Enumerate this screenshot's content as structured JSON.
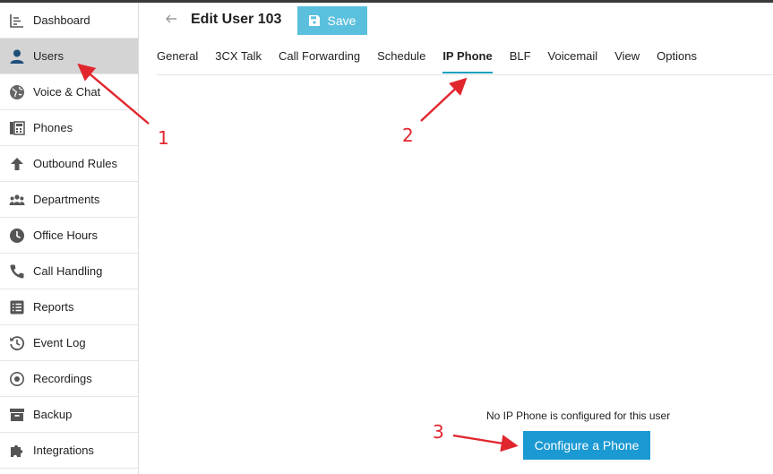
{
  "sidebar": {
    "items": [
      {
        "label": "Dashboard",
        "icon": "dashboard-icon",
        "active": false
      },
      {
        "label": "Users",
        "icon": "user-icon",
        "active": true
      },
      {
        "label": "Voice & Chat",
        "icon": "globe-icon",
        "active": false
      },
      {
        "label": "Phones",
        "icon": "phone-device-icon",
        "active": false
      },
      {
        "label": "Outbound Rules",
        "icon": "arrow-up-icon",
        "active": false
      },
      {
        "label": "Departments",
        "icon": "group-icon",
        "active": false
      },
      {
        "label": "Office Hours",
        "icon": "clock-icon",
        "active": false
      },
      {
        "label": "Call Handling",
        "icon": "handset-icon",
        "active": false
      },
      {
        "label": "Reports",
        "icon": "list-icon",
        "active": false
      },
      {
        "label": "Event Log",
        "icon": "history-icon",
        "active": false
      },
      {
        "label": "Recordings",
        "icon": "record-icon",
        "active": false
      },
      {
        "label": "Backup",
        "icon": "archive-icon",
        "active": false
      },
      {
        "label": "Integrations",
        "icon": "puzzle-icon",
        "active": false
      }
    ]
  },
  "header": {
    "title": "Edit User 103",
    "save_label": "Save"
  },
  "tabs": [
    {
      "label": "General",
      "active": false
    },
    {
      "label": "3CX Talk",
      "active": false
    },
    {
      "label": "Call Forwarding",
      "active": false
    },
    {
      "label": "Schedule",
      "active": false
    },
    {
      "label": "IP Phone",
      "active": true
    },
    {
      "label": "BLF",
      "active": false
    },
    {
      "label": "Voicemail",
      "active": false
    },
    {
      "label": "View",
      "active": false
    },
    {
      "label": "Options",
      "active": false
    }
  ],
  "content": {
    "empty_message": "No IP Phone is configured for this user",
    "configure_label": "Configure a Phone"
  },
  "annotations": {
    "color": "#e2262e",
    "labels": [
      "1",
      "2",
      "3"
    ]
  },
  "colors": {
    "save_button": "#5bc0de",
    "primary_button": "#1a99d3",
    "active_tab_underline": "#1a9fbf",
    "active_sidebar": "#d4d4d4"
  }
}
